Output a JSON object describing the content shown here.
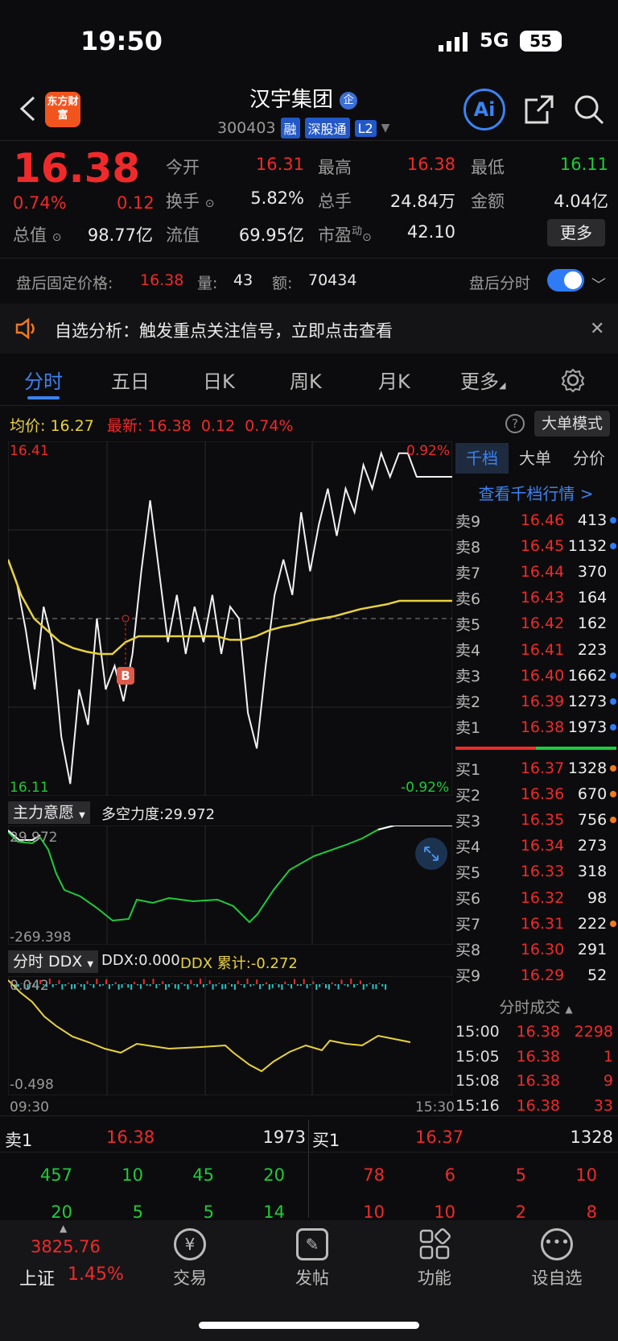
{
  "status": {
    "time": "19:50",
    "network": "5G",
    "battery": "55"
  },
  "header": {
    "logo_text": "东方财富",
    "stock_name": "汉宇集团",
    "enterprise_badge": "企",
    "code": "300403",
    "tags": [
      "融",
      "深股通",
      "L2"
    ],
    "ai_label": "Ai"
  },
  "quote": {
    "price": "16.38",
    "change_pct": "0.74%",
    "change": "0.12",
    "stats": [
      {
        "label": "今开",
        "value": "16.31",
        "color": "red"
      },
      {
        "label": "最高",
        "value": "16.38",
        "color": "red"
      },
      {
        "label": "最低",
        "value": "16.11",
        "color": "green"
      },
      {
        "label": "换手",
        "value": "5.82%",
        "color": "white"
      },
      {
        "label": "总手",
        "value": "24.84万",
        "color": "white"
      },
      {
        "label": "金额",
        "value": "4.04亿",
        "color": "white"
      },
      {
        "label": "总值",
        "value": "98.77亿",
        "color": "white"
      },
      {
        "label": "流值",
        "value": "69.95亿",
        "color": "white"
      },
      {
        "label": "市盈",
        "value": "42.10",
        "color": "white"
      }
    ],
    "pe_sup": "动",
    "more_label": "更多"
  },
  "after_hours": {
    "label": "盘后固定价格:",
    "price": "16.38",
    "vol_label": "量:",
    "vol": "43",
    "amt_label": "额:",
    "amt": "70434",
    "toggle_label": "盘后分时"
  },
  "banner": {
    "text": "自选分析：触发重点关注信号，立即点击查看"
  },
  "tabs": [
    "分时",
    "五日",
    "日K",
    "周K",
    "月K",
    "更多"
  ],
  "chart_header": {
    "avg_label": "均价:",
    "avg": "16.27",
    "latest_label": "最新:",
    "latest": "16.38",
    "chg": "0.12",
    "pct": "0.74%",
    "big_order": "大单模式"
  },
  "chart_labels": {
    "top_price": "16.41",
    "bottom_price": "16.11",
    "top_pct": "0.92%",
    "bottom_pct": "-0.92%",
    "b_marker": "B",
    "start_time": "09:30",
    "end_time": "15:30"
  },
  "indicator1": {
    "name": "主力意愿",
    "value_label": "多空力度:29.972",
    "top": "29.972",
    "bottom": "-269.398"
  },
  "indicator2": {
    "name": "分时 DDX",
    "ddx": "DDX:0.000",
    "ddx_cum": "DDX 累计:-0.272",
    "top": "0.042",
    "bottom": "-0.498"
  },
  "chart_data": {
    "type": "line",
    "title": "",
    "ylim": [
      16.11,
      16.41
    ],
    "series": [
      {
        "name": "最新",
        "values": [
          16.31,
          16.29,
          16.25,
          16.2,
          16.27,
          16.24,
          16.16,
          16.12,
          16.2,
          16.17,
          16.26,
          16.2,
          16.22,
          16.19,
          16.23,
          16.3,
          16.36,
          16.3,
          16.24,
          16.28,
          16.23,
          16.27,
          16.24,
          16.28,
          16.23,
          16.27,
          16.26,
          16.18,
          16.15,
          16.22,
          16.28,
          16.31,
          16.28,
          16.35,
          16.3,
          16.34,
          16.37,
          16.33,
          16.37,
          16.35,
          16.39,
          16.37,
          16.4,
          16.38,
          16.4,
          16.4,
          16.38,
          16.38
        ]
      },
      {
        "name": "均价",
        "values": [
          16.31,
          16.28,
          16.26,
          16.25,
          16.24,
          16.235,
          16.232,
          16.23,
          16.23,
          16.24,
          16.245,
          16.245,
          16.245,
          16.245,
          16.245,
          16.245,
          16.245,
          16.242,
          16.242,
          16.245,
          16.25,
          16.253,
          16.255,
          16.258,
          16.26,
          16.262,
          16.265,
          16.268,
          16.27,
          16.272,
          16.275,
          16.275,
          16.275
        ]
      }
    ]
  },
  "order_book": {
    "tabs": [
      "千档",
      "大单",
      "分价"
    ],
    "link": "查看千档行情 >",
    "sells": [
      {
        "label": "卖9",
        "price": "16.46",
        "vol": "413",
        "dot": "#2e7bf5"
      },
      {
        "label": "卖8",
        "price": "16.45",
        "vol": "1132",
        "dot": "#2e7bf5"
      },
      {
        "label": "卖7",
        "price": "16.44",
        "vol": "370",
        "dot": ""
      },
      {
        "label": "卖6",
        "price": "16.43",
        "vol": "164",
        "dot": ""
      },
      {
        "label": "卖5",
        "price": "16.42",
        "vol": "162",
        "dot": ""
      },
      {
        "label": "卖4",
        "price": "16.41",
        "vol": "223",
        "dot": ""
      },
      {
        "label": "卖3",
        "price": "16.40",
        "vol": "1662",
        "dot": "#2e7bf5"
      },
      {
        "label": "卖2",
        "price": "16.39",
        "vol": "1273",
        "dot": "#2e7bf5"
      },
      {
        "label": "卖1",
        "price": "16.38",
        "vol": "1973",
        "dot": "#2e7bf5"
      }
    ],
    "buys": [
      {
        "label": "买1",
        "price": "16.37",
        "vol": "1328",
        "dot": "#f07a1e"
      },
      {
        "label": "买2",
        "price": "16.36",
        "vol": "670",
        "dot": "#f07a1e"
      },
      {
        "label": "买3",
        "price": "16.35",
        "vol": "756",
        "dot": "#f07a1e"
      },
      {
        "label": "买4",
        "price": "16.34",
        "vol": "273",
        "dot": ""
      },
      {
        "label": "买5",
        "price": "16.33",
        "vol": "318",
        "dot": ""
      },
      {
        "label": "买6",
        "price": "16.32",
        "vol": "98",
        "dot": ""
      },
      {
        "label": "买7",
        "price": "16.31",
        "vol": "222",
        "dot": "#f07a1e"
      },
      {
        "label": "买8",
        "price": "16.30",
        "vol": "291",
        "dot": ""
      },
      {
        "label": "买9",
        "price": "16.29",
        "vol": "52",
        "dot": ""
      }
    ],
    "trades_title": "分时成交",
    "trades": [
      {
        "time": "15:00",
        "price": "16.38",
        "vol": "2298"
      },
      {
        "time": "15:05",
        "price": "16.38",
        "vol": "1"
      },
      {
        "time": "15:08",
        "price": "16.38",
        "vol": "9"
      },
      {
        "time": "15:16",
        "price": "16.38",
        "vol": "33"
      }
    ]
  },
  "bottom_quote": {
    "sell_label": "卖1",
    "sell_price": "16.38",
    "sell_vol": "1973",
    "buy_label": "买1",
    "buy_price": "16.37",
    "buy_vol": "1328",
    "sell_queue": [
      [
        "457",
        "10",
        "45",
        "20"
      ],
      [
        "20",
        "5",
        "5",
        "14"
      ]
    ],
    "buy_queue": [
      [
        "78",
        "6",
        "5",
        "10"
      ],
      [
        "10",
        "10",
        "2",
        "8"
      ]
    ]
  },
  "bottom_nav": {
    "index_value": "3825.76",
    "index_name": "上证",
    "index_pct": "1.45%",
    "items": [
      "交易",
      "发帖",
      "功能",
      "设自选"
    ]
  }
}
